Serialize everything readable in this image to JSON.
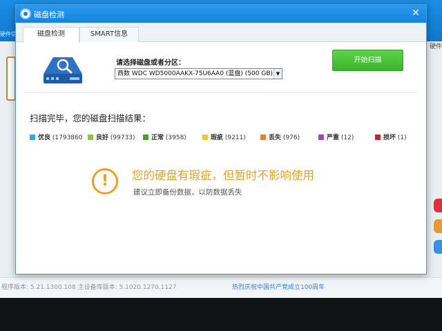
{
  "host": {
    "left_label": "硬件信",
    "right_label": "硬件",
    "status_left": "程序版本: 5.21.1300.108   主设备库版本: 5.1020.1270.1127",
    "status_center": "热烈庆祝中国共产党成立100周年"
  },
  "dialog": {
    "title": "磁盘检测",
    "tabs": [
      {
        "label": "磁盘检测"
      },
      {
        "label": "SMART信息"
      }
    ],
    "select_label": "请选择磁盘或者分区：",
    "disk_selected": "西数 WDC WD5000AAKX-75U6AA0 (蓝盘)  (500 GB)",
    "scan_button": "开始扫描",
    "result_title": "扫描完毕，您的磁盘扫描结果：",
    "legend": [
      {
        "label": "优良",
        "count": "(1793860",
        "color": "#3aa7e0"
      },
      {
        "label": "良好",
        "count": "(99733)",
        "color": "#8dc63f"
      },
      {
        "label": "正常",
        "count": "(3958)",
        "color": "#4f9a2e"
      },
      {
        "label": "瑕疵",
        "count": "(9211)",
        "color": "#e4cf2a"
      },
      {
        "label": "丢失",
        "count": "(976)",
        "color": "#e0823a"
      },
      {
        "label": "严重",
        "count": "(12)",
        "color": "#a04aa8"
      },
      {
        "label": "损坏",
        "count": "(1)",
        "color": "#c2272d"
      }
    ],
    "warning_title": "您的硬盘有瑕疵，但暂时不影响使用",
    "warning_sub": "建议立即备份数据，以防数据丢失",
    "accent_color": "#e8a024",
    "close_icon": "close-icon",
    "warning_icon": "exclamation-icon"
  }
}
